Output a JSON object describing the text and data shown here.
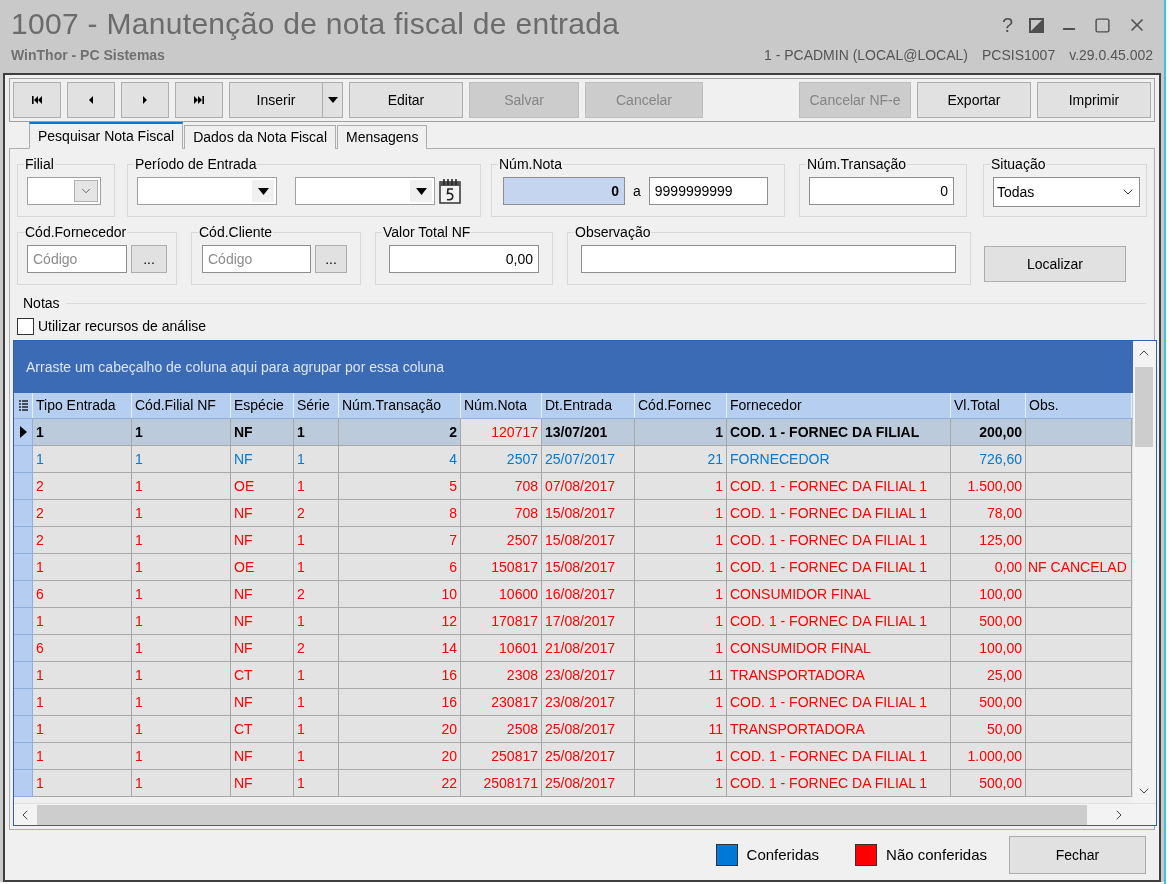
{
  "window": {
    "title": "1007 - Manutenção de nota fiscal de entrada",
    "subtitle": "WinThor - PC Sistemas",
    "help": "?",
    "session": [
      "1 - PCADMIN (LOCAL@LOCAL)",
      "PCSIS1007",
      "v.29.0.45.002"
    ]
  },
  "toolbar": {
    "left": [
      {
        "label": "Inserir",
        "disabled": false,
        "kind": "split"
      },
      {
        "label": "Editar",
        "disabled": false,
        "kind": "plain"
      },
      {
        "label": "Salvar",
        "disabled": true,
        "kind": "plain"
      },
      {
        "label": "Cancelar",
        "disabled": true,
        "kind": "plain"
      }
    ],
    "right": [
      {
        "label": "Cancelar NF-e",
        "disabled": true,
        "kind": "plain"
      },
      {
        "label": "Exportar",
        "disabled": false,
        "kind": "plain"
      },
      {
        "label": "Imprimir",
        "disabled": false,
        "kind": "plain"
      }
    ]
  },
  "tabs": [
    {
      "label": "Pesquisar Nota Fiscal",
      "selected": true
    },
    {
      "label": "Dados da Nota Fiscal",
      "selected": false
    },
    {
      "label": "Mensagens",
      "selected": false
    }
  ],
  "filters": {
    "filial": {
      "label": "Filial"
    },
    "periodo": {
      "label": "Período de Entrada"
    },
    "num_nota": {
      "label": "Núm.Nota",
      "from": "0",
      "from_focused": true,
      "separator": "a",
      "to": "9999999999"
    },
    "num_transacao": {
      "label": "Núm.Transação",
      "value": "0"
    },
    "situacao": {
      "label": "Situação",
      "value": "Todas"
    },
    "cod_fornecedor": {
      "label": "Cód.Fornecedor",
      "placeholder": "Código",
      "button": "..."
    },
    "cod_cliente": {
      "label": "Cód.Cliente",
      "placeholder": "Código",
      "button": "..."
    },
    "valor_total": {
      "label": "Valor Total NF",
      "value": "0,00"
    },
    "observacao": {
      "label": "Observação"
    },
    "search_button": "Localizar"
  },
  "notas": {
    "label": "Notas",
    "analysis_option": {
      "label": "Utilizar recursos de análise",
      "checked": false
    }
  },
  "table": {
    "group_hint": "Arraste um cabeçalho de coluna aqui para agrupar por essa coluna",
    "columns": [
      {
        "label": "Tipo Entrada",
        "focused": false
      },
      {
        "label": "Cód.Filial NF",
        "focused": false
      },
      {
        "label": "Espécie",
        "focused": false
      },
      {
        "label": "Série",
        "focused": false
      },
      {
        "label": "Núm.Transação",
        "focused": false
      },
      {
        "label": "Núm.Nota",
        "focused": true
      },
      {
        "label": "Dt.Entrada",
        "focused": false
      },
      {
        "label": "Cód.Fornec",
        "focused": false
      },
      {
        "label": "Fornecedor",
        "focused": false
      },
      {
        "label": "Vl.Total",
        "focused": false
      },
      {
        "label": "Obs.",
        "focused": false
      }
    ],
    "rows": [
      {
        "selected": true,
        "conferida": false,
        "cells": [
          "1",
          "1",
          "NF",
          "1",
          "2",
          "120717",
          "13/07/201",
          "1",
          "COD. 1 - FORNEC DA FILIAL",
          "200,00"
        ]
      },
      {
        "selected": false,
        "conferida": true,
        "cells": [
          "1",
          "1",
          "NF",
          "1",
          "4",
          "2507",
          "25/07/2017",
          "21",
          "FORNECEDOR",
          "726,60"
        ]
      },
      {
        "selected": false,
        "conferida": false,
        "cells": [
          "2",
          "1",
          "OE",
          "1",
          "5",
          "708",
          "07/08/2017",
          "1",
          "COD. 1 - FORNEC DA FILIAL 1",
          "1.500,00"
        ]
      },
      {
        "selected": false,
        "conferida": false,
        "cells": [
          "2",
          "1",
          "NF",
          "2",
          "8",
          "708",
          "15/08/2017",
          "1",
          "COD. 1 - FORNEC DA FILIAL 1",
          "78,00"
        ]
      },
      {
        "selected": false,
        "conferida": false,
        "cells": [
          "2",
          "1",
          "NF",
          "1",
          "7",
          "2507",
          "15/08/2017",
          "1",
          "COD. 1 - FORNEC DA FILIAL 1",
          "125,00"
        ]
      },
      {
        "selected": false,
        "conferida": false,
        "cells": [
          "1",
          "1",
          "OE",
          "1",
          "6",
          "150817",
          "15/08/2017",
          "1",
          "COD. 1 - FORNEC DA FILIAL 1",
          "0,00",
          "NF CANCELAD"
        ]
      },
      {
        "selected": false,
        "conferida": false,
        "cells": [
          "6",
          "1",
          "NF",
          "2",
          "10",
          "10600",
          "16/08/2017",
          "1",
          "CONSUMIDOR FINAL",
          "100,00"
        ]
      },
      {
        "selected": false,
        "conferida": false,
        "cells": [
          "1",
          "1",
          "NF",
          "1",
          "12",
          "170817",
          "17/08/2017",
          "1",
          "COD. 1 - FORNEC DA FILIAL 1",
          "500,00"
        ]
      },
      {
        "selected": false,
        "conferida": false,
        "cells": [
          "6",
          "1",
          "NF",
          "2",
          "14",
          "10601",
          "21/08/2017",
          "1",
          "CONSUMIDOR FINAL",
          "100,00"
        ]
      },
      {
        "selected": false,
        "conferida": false,
        "cells": [
          "1",
          "1",
          "CT",
          "1",
          "16",
          "2308",
          "23/08/2017",
          "11",
          "TRANSPORTADORA",
          "25,00"
        ]
      },
      {
        "selected": false,
        "conferida": false,
        "cells": [
          "1",
          "1",
          "NF",
          "1",
          "16",
          "230817",
          "23/08/2017",
          "1",
          "COD. 1 - FORNEC DA FILIAL 1",
          "500,00"
        ]
      },
      {
        "selected": false,
        "conferida": false,
        "cells": [
          "1",
          "1",
          "CT",
          "1",
          "20",
          "2508",
          "25/08/2017",
          "11",
          "TRANSPORTADORA",
          "50,00"
        ]
      },
      {
        "selected": false,
        "conferida": false,
        "cells": [
          "1",
          "1",
          "NF",
          "1",
          "20",
          "250817",
          "25/08/2017",
          "1",
          "COD. 1 - FORNEC DA FILIAL 1",
          "1.000,00"
        ]
      },
      {
        "selected": false,
        "conferida": false,
        "cells": [
          "1",
          "1",
          "NF",
          "1",
          "22",
          "2508171",
          "25/08/2017",
          "1",
          "COD. 1 - FORNEC DA FILIAL 1",
          "500,00"
        ]
      }
    ]
  },
  "legend": [
    {
      "label": "Conferidas",
      "color": "#0078d7"
    },
    {
      "label": "Não conferidas",
      "color": "#ff0000"
    }
  ],
  "close_button": "Fechar"
}
